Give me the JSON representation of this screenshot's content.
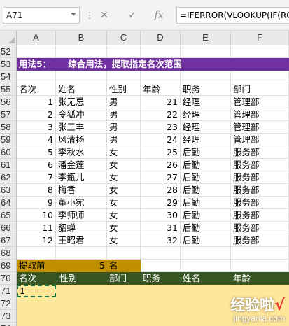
{
  "formula_bar": {
    "name_box": "A71",
    "separator": "⋮",
    "cancel_glyph": "✕",
    "enter_glyph": "✓",
    "fx_glyph": "fx",
    "formula": "=IFERROR(VLOOKUP(IF(RO"
  },
  "columns": [
    "A",
    "B",
    "C",
    "D",
    "E",
    "F"
  ],
  "rows": {
    "r52": "52",
    "r53": "53",
    "r54": "54",
    "r55": "55",
    "r68": "68",
    "r69": "69",
    "r70": "70",
    "r71": "71",
    "r72": "72",
    "r73": "73",
    "r74": "74"
  },
  "section_title": {
    "label": "用法5：",
    "desc": "综合用法，提取指定名次范围"
  },
  "table_header": [
    "名次",
    "姓名",
    "性别",
    "年龄",
    "职务",
    "部门"
  ],
  "table_rows": [
    {
      "row": "56",
      "rank": "1",
      "name": "张无忌",
      "gender": "男",
      "age": "21",
      "title": "经理",
      "dept": "管理部"
    },
    {
      "row": "57",
      "rank": "2",
      "name": "令狐冲",
      "gender": "男",
      "age": "22",
      "title": "经理",
      "dept": "管理部"
    },
    {
      "row": "58",
      "rank": "3",
      "name": "张三丰",
      "gender": "男",
      "age": "23",
      "title": "经理",
      "dept": "管理部"
    },
    {
      "row": "59",
      "rank": "4",
      "name": "风清扬",
      "gender": "男",
      "age": "24",
      "title": "经理",
      "dept": "管理部"
    },
    {
      "row": "60",
      "rank": "5",
      "name": "李秋水",
      "gender": "女",
      "age": "25",
      "title": "后勤",
      "dept": "服务部"
    },
    {
      "row": "61",
      "rank": "6",
      "name": "潘金莲",
      "gender": "女",
      "age": "26",
      "title": "后勤",
      "dept": "服务部"
    },
    {
      "row": "62",
      "rank": "7",
      "name": "李瓶儿",
      "gender": "女",
      "age": "27",
      "title": "后勤",
      "dept": "服务部"
    },
    {
      "row": "63",
      "rank": "8",
      "name": "梅香",
      "gender": "女",
      "age": "28",
      "title": "后勤",
      "dept": "服务部"
    },
    {
      "row": "64",
      "rank": "9",
      "name": "董小宛",
      "gender": "女",
      "age": "29",
      "title": "后勤",
      "dept": "服务部"
    },
    {
      "row": "65",
      "rank": "10",
      "name": "李师师",
      "gender": "女",
      "age": "30",
      "title": "后勤",
      "dept": "服务部"
    },
    {
      "row": "66",
      "rank": "11",
      "name": "貂蝉",
      "gender": "女",
      "age": "31",
      "title": "后勤",
      "dept": "服务部"
    },
    {
      "row": "67",
      "rank": "12",
      "name": "王昭君",
      "gender": "女",
      "age": "32",
      "title": "后勤",
      "dept": "服务部"
    }
  ],
  "extract_row": {
    "label": "提取前",
    "count": "5",
    "unit": "名"
  },
  "result_header": [
    "名次",
    "性别",
    "部门",
    "职务",
    "姓名",
    "年龄"
  ],
  "result_first": "1",
  "watermark": {
    "main": "经验啦",
    "check": "√",
    "url": "jingyanla.com"
  },
  "colors": {
    "purple": "#7030a0",
    "gold": "#bf8f00",
    "dark_green": "#375623",
    "light_yellow": "#ffe699",
    "selection": "#217346"
  }
}
